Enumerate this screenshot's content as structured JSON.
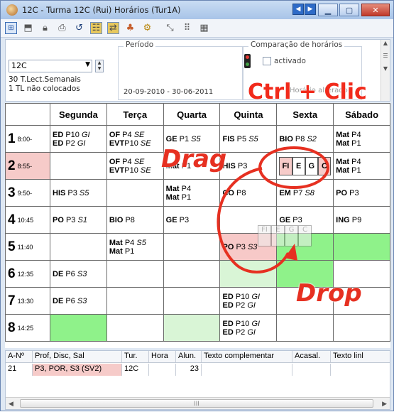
{
  "window": {
    "title": "12C - Turma 12C (Rui)  Horários  (Tur1A)"
  },
  "toolbar": {
    "icons": [
      "grid-icon",
      "chair-icon",
      "lock-icon",
      "print-icon",
      "undo-icon",
      "group-icon",
      "swap-icon",
      "tree-icon",
      "gears-icon",
      "resize-icon",
      "dotted-grid-icon",
      "calendar-grid-icon"
    ]
  },
  "filter": {
    "class_value": "12C",
    "sem_line1": "30  T.Lect.Semanais",
    "sem_line2": "1  TL não colocados",
    "period_label": "Período",
    "period_value": "20-09-2010 - 30-06-2011",
    "compare_label": "Comparação de horários",
    "activated_label": "activado",
    "hidden_text": "Horário alterado"
  },
  "grid": {
    "days": [
      "Segunda",
      "Terça",
      "Quarta",
      "Quinta",
      "Sexta",
      "Sábado"
    ],
    "rows": [
      {
        "num": "1",
        "time": "8:00-"
      },
      {
        "num": "2",
        "time": "8:55-"
      },
      {
        "num": "3",
        "time": "9:50-"
      },
      {
        "num": "4",
        "time": "10:45"
      },
      {
        "num": "5",
        "time": "11:40"
      },
      {
        "num": "6",
        "time": "12:35"
      },
      {
        "num": "7",
        "time": "13:30"
      },
      {
        "num": "8",
        "time": "14:25"
      }
    ],
    "cells": {
      "r1_seg_a": [
        "ED",
        " P10 ",
        "GI"
      ],
      "r1_seg_b": [
        "ED",
        " P2 ",
        "GI"
      ],
      "r1_ter_a": [
        "OF",
        " P4 ",
        "SE"
      ],
      "r1_ter_b": [
        "EVT",
        "P10 ",
        "SE"
      ],
      "r1_qua": [
        "GE",
        " P1 ",
        "S5"
      ],
      "r1_qui": [
        "FIS",
        " P5 ",
        "S5"
      ],
      "r1_sex": [
        "BIO",
        " P8 ",
        "S2"
      ],
      "r1_sab_a": [
        "Mat",
        " P4",
        ""
      ],
      "r1_sab_b": [
        "Mat",
        " P1",
        ""
      ],
      "r2_ter_a": [
        "OF",
        " P4 ",
        "SE"
      ],
      "r2_ter_b": [
        "EVT",
        "P10 ",
        "SE"
      ],
      "r2_qua": [
        "Mat",
        " P1",
        ""
      ],
      "r2_qui": [
        "HIS",
        " P3",
        ""
      ],
      "r2_sex_cells": [
        "FI",
        "E",
        "G",
        "C"
      ],
      "r2_sab_a": [
        "Mat",
        " P4",
        ""
      ],
      "r2_sab_b": [
        "Mat",
        " P1",
        ""
      ],
      "r3_seg": [
        "HIS",
        " P3 ",
        "S5"
      ],
      "r3_qua_a": [
        "Mat",
        " P4",
        ""
      ],
      "r3_qua_b": [
        "Mat",
        " P1",
        ""
      ],
      "r3_qui": [
        "CO",
        " P8",
        ""
      ],
      "r3_sex": [
        "EM",
        " P7 ",
        "S8"
      ],
      "r3_sab": [
        "PO",
        " P3",
        ""
      ],
      "r4_seg": [
        "PO",
        " P3 ",
        "S1"
      ],
      "r4_ter": [
        "BIO",
        " P8",
        ""
      ],
      "r4_qua": [
        "GE",
        " P3",
        ""
      ],
      "r4_sex": [
        "GE",
        " P3",
        ""
      ],
      "r4_sab": [
        "ING",
        " P9",
        ""
      ],
      "r5_ter_a": [
        "Mat",
        " P4 ",
        "S5"
      ],
      "r5_ter_b": [
        "Mat",
        " P1",
        ""
      ],
      "r5_qui": [
        "PO",
        " P3 ",
        "S3"
      ],
      "r6_seg": [
        "DE",
        " P6 ",
        "S3"
      ],
      "r7_seg": [
        "DE",
        " P6 ",
        "S3"
      ],
      "r7_qui_a": [
        "ED",
        " P10 ",
        "GI"
      ],
      "r7_qui_b": [
        "ED",
        " P2 ",
        "GI"
      ],
      "r8_qui_a": [
        "ED",
        " P10 ",
        "GI"
      ],
      "r8_qui_b": [
        "ED",
        " P2 ",
        "GI"
      ]
    },
    "ghost_cells": [
      "FI",
      "E",
      "G",
      "C"
    ]
  },
  "annotations": {
    "ctrl": "Ctrl + Clic",
    "drag": "Drag",
    "drop": "Drop"
  },
  "list": {
    "headers": [
      "A-Nº",
      "Prof, Disc, Sal",
      "Tur.",
      "Hora",
      "Alun.",
      "Texto complementar",
      "Acasal.",
      "Texto linl"
    ],
    "row": [
      "21",
      "P3, POR, S3 (SV2)",
      "12C",
      "",
      "23",
      "",
      "",
      ""
    ]
  },
  "scroll": {
    "thumb_glyph": "III"
  },
  "colors": {
    "accent": "#e63021",
    "highlight_pink": "#f6cbc9",
    "green": "#8ff28a"
  }
}
